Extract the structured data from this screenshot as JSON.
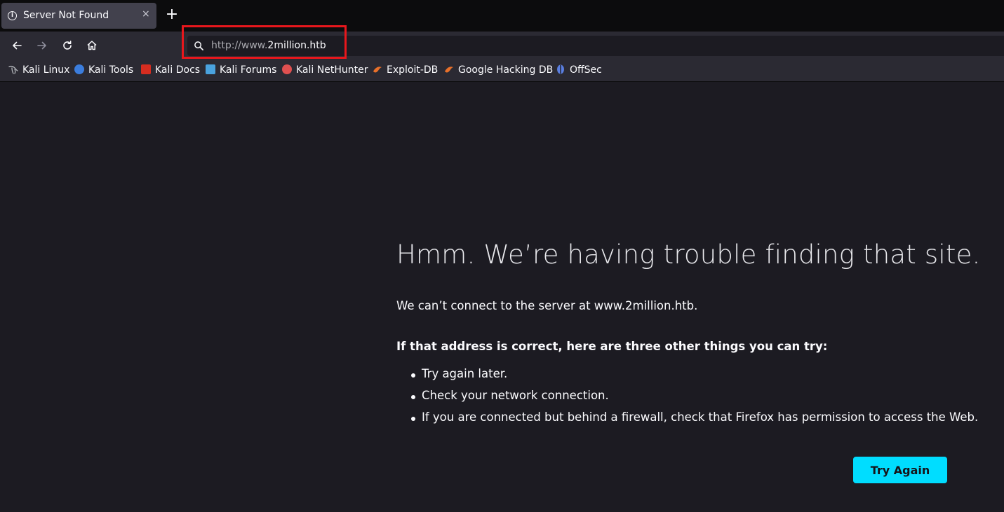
{
  "tab": {
    "title": "Server Not Found",
    "close_glyph": "×",
    "icon": "info-icon"
  },
  "new_tab_glyph": "+",
  "nav": {
    "back_icon": "back-arrow-icon",
    "forward_icon": "forward-arrow-icon",
    "reload_icon": "reload-icon",
    "home_icon": "home-icon"
  },
  "url": {
    "scheme": "http://www.",
    "host": "2million.htb"
  },
  "bookmarks": [
    {
      "label": "Kali Linux",
      "icon": "kali-dragon-icon",
      "color": "#9aa0a6"
    },
    {
      "label": "Kali Tools",
      "icon": "kali-tools-icon",
      "color": "#3b7ddd"
    },
    {
      "label": "Kali Docs",
      "icon": "kali-docs-icon",
      "color": "#d62d20"
    },
    {
      "label": "Kali Forums",
      "icon": "kali-forums-icon",
      "color": "#4aa3df"
    },
    {
      "label": "Kali NetHunter",
      "icon": "kali-nethunter-icon",
      "color": "#e05050"
    },
    {
      "label": "Exploit-DB",
      "icon": "exploit-db-icon",
      "color": "#e8702a"
    },
    {
      "label": "Google Hacking DB",
      "icon": "ghdb-icon",
      "color": "#e8702a"
    },
    {
      "label": "OffSec",
      "icon": "offsec-icon",
      "color": "#5b7fe0"
    }
  ],
  "error": {
    "title": "Hmm. We’re having trouble finding that site.",
    "description": "We can’t connect to the server at www.2million.htb.",
    "subtitle": "If that address is correct, here are three other things you can try:",
    "tips": [
      "Try again later.",
      "Check your network connection.",
      "If you are connected but behind a firewall, check that Firefox has permission to access the Web."
    ],
    "button_label": "Try Again"
  },
  "colors": {
    "accent": "#00ddff",
    "highlight": "#e8171c"
  }
}
